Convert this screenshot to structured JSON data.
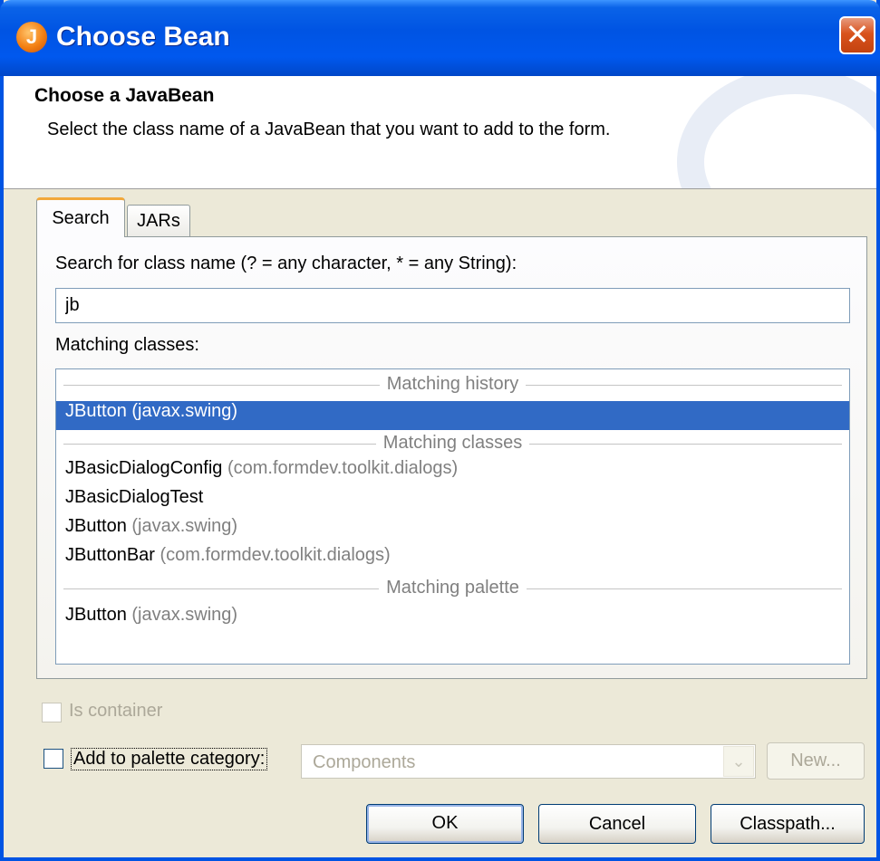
{
  "window": {
    "title": "Choose Bean",
    "icon": "java-app-icon",
    "close_glyph": "✕"
  },
  "header": {
    "title": "Choose a JavaBean",
    "description": "Select the class name of a JavaBean that you want to add to the form."
  },
  "tabs": [
    {
      "label": "Search",
      "selected": true
    },
    {
      "label": "JARs",
      "selected": false
    }
  ],
  "search": {
    "label": "Search for class name (? = any character, * = any String):",
    "value": "jb",
    "matching_label": "Matching classes:"
  },
  "results": {
    "history_header": "Matching history",
    "history": [
      {
        "class": "JButton",
        "package": "(javax.swing)",
        "selected": true
      }
    ],
    "classes_header": "Matching classes",
    "classes": [
      {
        "class": "JBasicDialogConfig",
        "package": "(com.formdev.toolkit.dialogs)"
      },
      {
        "class": "JBasicDialogTest",
        "package": ""
      },
      {
        "class": "JButton",
        "package": "(javax.swing)"
      },
      {
        "class": "JButtonBar",
        "package": "(com.formdev.toolkit.dialogs)"
      }
    ],
    "palette_header": "Matching palette",
    "palette": [
      {
        "class": "JButton",
        "package": "(javax.swing)"
      }
    ]
  },
  "options": {
    "is_container_label": "Is container",
    "is_container_checked": false,
    "is_container_enabled": false,
    "add_palette_label": "Add to palette category:",
    "add_palette_checked": false,
    "category_value": "Components",
    "new_button": "New..."
  },
  "buttons": {
    "ok": "OK",
    "cancel": "Cancel",
    "classpath": "Classpath..."
  },
  "colors": {
    "titlebar": "#0054e3",
    "selection": "#316ac5",
    "dialog_bg": "#ece9d8",
    "tab_accent": "#f2a83a"
  }
}
